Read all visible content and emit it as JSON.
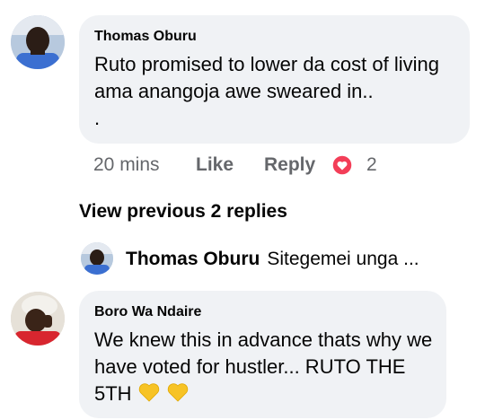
{
  "comments": [
    {
      "author": "Thomas Oburu",
      "text": "Ruto promised to lower da cost of living ama anangoja awe sweared in..\n.",
      "time": "20 mins",
      "like_label": "Like",
      "reply_label": "Reply",
      "reaction_count": "2",
      "reaction_icon": "heart-reaction-icon",
      "reaction_color": "#f33e58"
    },
    {
      "author": "Boro Wa Ndaire",
      "text": "We knew this in advance thats why we have voted for hustler... RUTO THE 5TH",
      "emojis": [
        "yellow-heart-icon",
        "yellow-heart-icon"
      ],
      "emoji_color": "#f7c325"
    }
  ],
  "replies": {
    "view_previous_label": "View previous 2 replies",
    "latest": {
      "author": "Thomas Oburu",
      "snippet": "Sitegemei unga ..."
    }
  }
}
